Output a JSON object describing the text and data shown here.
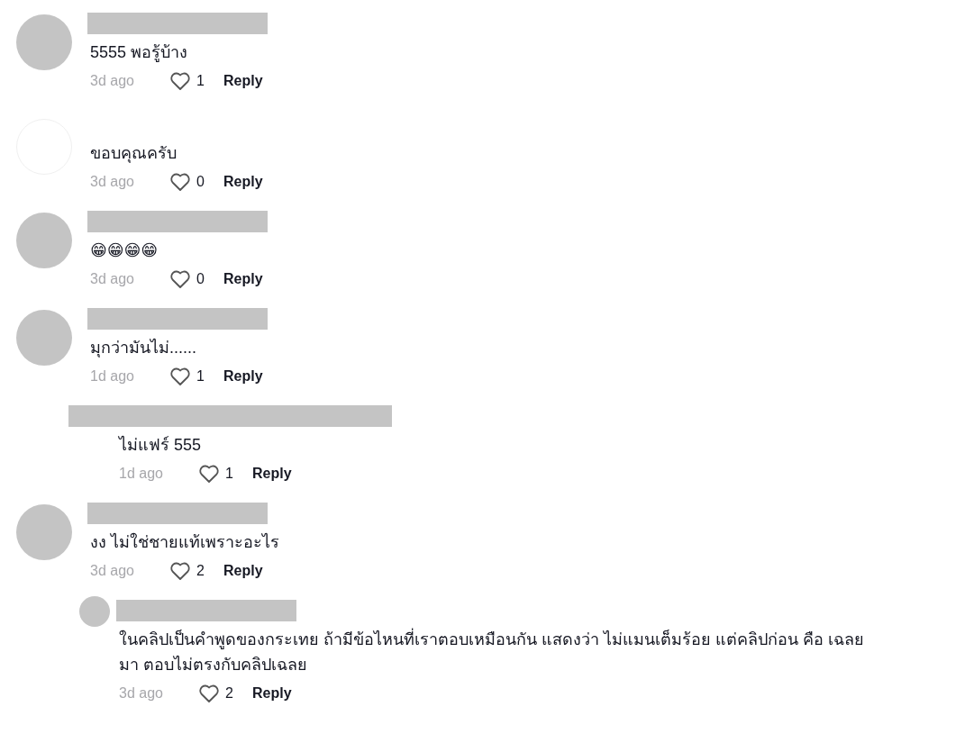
{
  "comments": [
    {
      "kind": "comment",
      "avatar": {
        "kind": "filled"
      },
      "name_redacted": true,
      "text": "5555 พอรู้บ้าง",
      "time": "3d ago",
      "likes": "1",
      "reply": "Reply"
    },
    {
      "kind": "comment",
      "avatar": {
        "kind": "blank"
      },
      "name_redacted": false,
      "text": "ขอบคุณครับ",
      "time": "3d ago",
      "likes": "0",
      "reply": "Reply"
    },
    {
      "kind": "comment",
      "avatar": {
        "kind": "filled"
      },
      "name_redacted": true,
      "text": "😁😁😁😁",
      "time": "3d ago",
      "likes": "0",
      "reply": "Reply"
    },
    {
      "kind": "comment",
      "avatar": {
        "kind": "filled"
      },
      "name_redacted": true,
      "text": "มุกว่ามันไม่......",
      "time": "1d ago",
      "likes": "1",
      "reply": "Reply"
    },
    {
      "kind": "reply",
      "name_redacted": true,
      "text": "ไม่แฟร์ 555",
      "time": "1d ago",
      "likes": "1",
      "reply": "Reply"
    },
    {
      "kind": "comment",
      "avatar": {
        "kind": "filled"
      },
      "name_redacted": true,
      "text": "งง ไม่ใช่ชายแท้เพราะอะไร",
      "time": "3d ago",
      "likes": "2",
      "reply": "Reply"
    },
    {
      "kind": "reply",
      "avatar": {
        "kind": "filled"
      },
      "name_redacted": true,
      "text": "ในคลิปเป็นคำพูดของกระเทย ถ้ามีข้อไหนที่เราตอบเหมือนกัน แสดงว่า ไม่แมนเต็มร้อย แต่คลิปก่อน คือ เฉลย มา ตอบไม่ตรงกับคลิปเฉลย",
      "time": "3d ago",
      "likes": "2",
      "reply": "Reply"
    }
  ]
}
